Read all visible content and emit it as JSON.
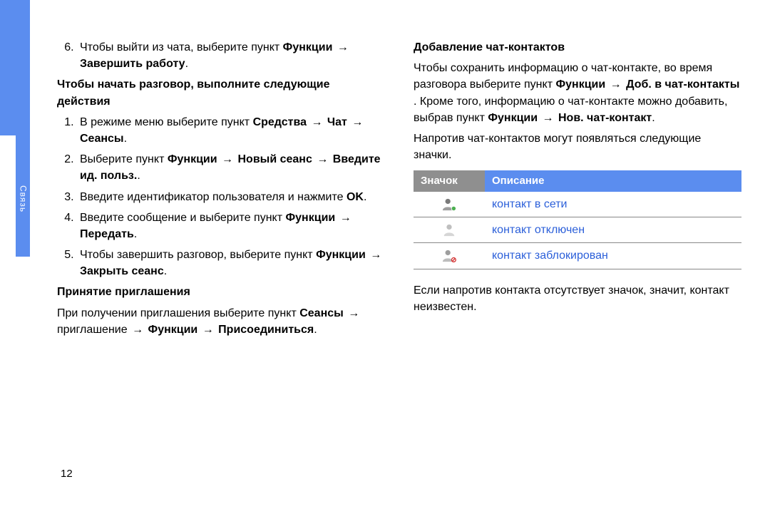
{
  "sidebar": {
    "label": "Связь"
  },
  "left": {
    "exit_num": "6.",
    "exit_txt_a": "Чтобы выйти из чата, выберите пункт ",
    "exit_b1": "Функции",
    "exit_arr": "→",
    "exit_b2": "Завершить работу",
    "exit_dot": ".",
    "h1": "Чтобы начать разговор, выполните следующие действия",
    "s1_a": "В режиме меню выберите пункт ",
    "s1_b1": "Средства",
    "s1_b2": "Чат",
    "s1_b3": "Сеансы",
    "s2_a": "Выберите пункт ",
    "s2_b1": "Функции",
    "s2_b2": "Новый сеанс",
    "s2_b3": "Введите ид. польз.",
    "s3_a": "Введите идентификатор пользователя и нажмите ",
    "s3_b1": "OK",
    "s4_a": "Введите сообщение и выберите пункт ",
    "s4_b1": "Функции",
    "s4_b2": "Передать",
    "s5_a": "Чтобы завершить разговор, выберите пункт ",
    "s5_b1": "Функции",
    "s5_b2": "Закрыть сеанс",
    "h2": "Принятие приглашения",
    "inv_a": "При получении приглашения выберите пункт ",
    "inv_b1": "Сеансы",
    "inv_mid": " приглашение ",
    "inv_b2": "Функции",
    "inv_b3": "Присоединиться"
  },
  "right": {
    "h1": "Добавление чат-контактов",
    "p1_a": "Чтобы сохранить информацию о чат-контакте, во время разговора выберите пункт ",
    "p1_b1": "Функции",
    "p1_b2": "Доб. в чат-контакты",
    "p1_c": ". Кроме того, информацию о чат-контакте можно добавить, выбрав пункт ",
    "p1_b3": "Функции",
    "p1_b4": "Нов. чат-контакт",
    "p2": "Напротив чат-контактов могут появляться следующие значки.",
    "th1": "Значок",
    "th2": "Описание",
    "row1": "контакт в сети",
    "row2": "контакт отключен",
    "row3": "контакт заблокирован",
    "p3": "Если напротив контакта отсутствует значок, значит, контакт неизвестен."
  },
  "page_number": "12",
  "icons": {
    "online": {
      "head": "#7a7a7a",
      "body": "#9e9e9e",
      "dot": "#4caf50"
    },
    "offline": {
      "head": "#bfbfbf",
      "body": "#d6d6d6",
      "dot": "none"
    },
    "blocked": {
      "head": "#9e9e9e",
      "body": "#bdbdbd",
      "dot": "#d32f2f"
    }
  }
}
